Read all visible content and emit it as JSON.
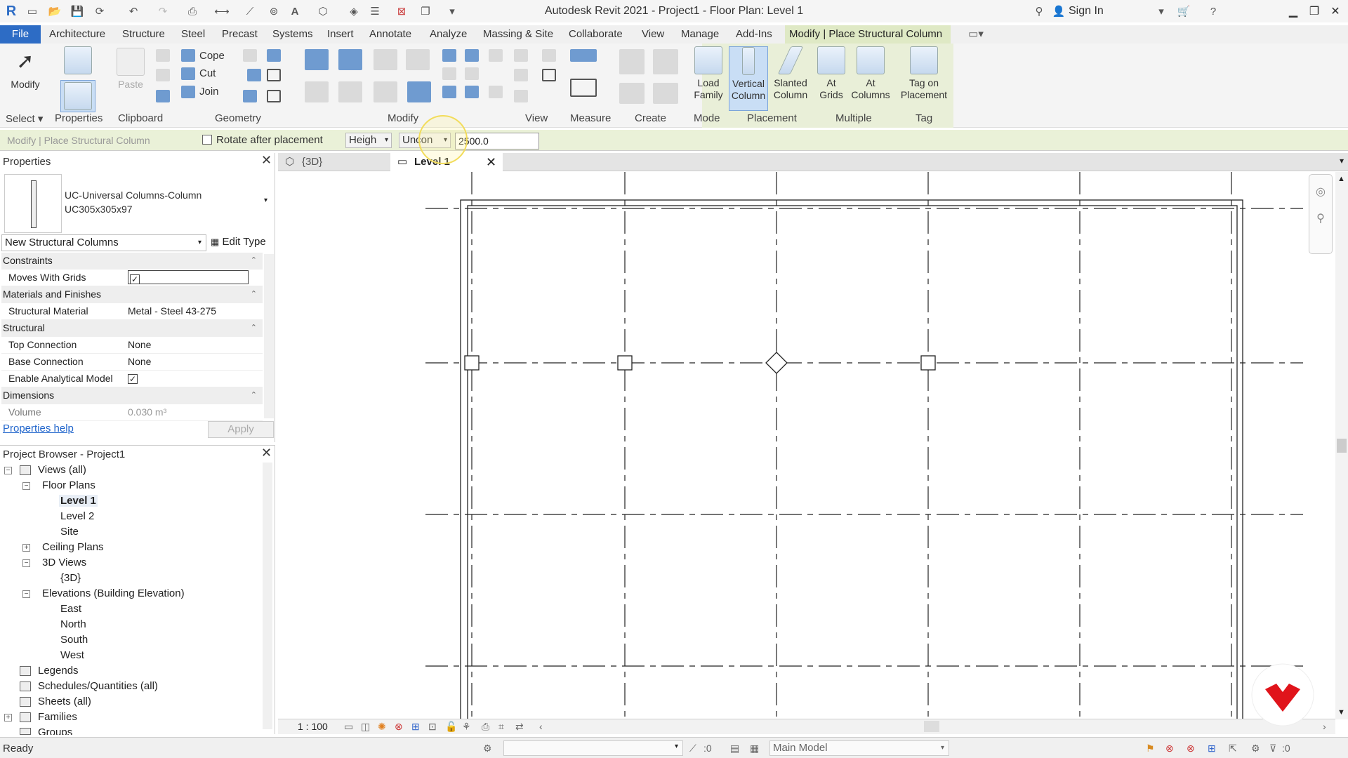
{
  "titlebar": {
    "title": "Autodesk Revit 2021 - Project1 - Floor Plan: Level 1",
    "signin": "Sign In",
    "app_glyph": "R",
    "minimize": "▁",
    "restore": "❐",
    "close": "✕"
  },
  "ribbon_tabs": [
    {
      "label": "File"
    },
    {
      "label": "Architecture"
    },
    {
      "label": "Structure"
    },
    {
      "label": "Steel"
    },
    {
      "label": "Precast"
    },
    {
      "label": "Systems"
    },
    {
      "label": "Insert"
    },
    {
      "label": "Annotate"
    },
    {
      "label": "Analyze"
    },
    {
      "label": "Massing & Site"
    },
    {
      "label": "Collaborate"
    },
    {
      "label": "View"
    },
    {
      "label": "Manage"
    },
    {
      "label": "Add-Ins"
    },
    {
      "label": "Modify | Place Structural Column"
    }
  ],
  "ribbon": {
    "modify": "Modify",
    "paste": "Paste",
    "cope": "Cope",
    "cut": "Cut",
    "join": "Join",
    "load_family": [
      "Load",
      "Family"
    ],
    "vertical_column": [
      "Vertical",
      "Column"
    ],
    "slanted_column": [
      "Slanted",
      "Column"
    ],
    "at_grids": [
      "At",
      "Grids"
    ],
    "at_columns": [
      "At",
      "Columns"
    ],
    "tag_on_placement": [
      "Tag on",
      "Placement"
    ],
    "panels": [
      "Select",
      "Properties",
      "Clipboard",
      "Geometry",
      "Modify",
      "View",
      "Measure",
      "Create",
      "Mode",
      "Placement",
      "Multiple",
      "Tag"
    ]
  },
  "options_bar": {
    "context": "Modify | Place Structural Column",
    "rotate_label": "Rotate after placement",
    "height_mode": "Heigh",
    "level": "Uncon",
    "value": "2500.0"
  },
  "properties": {
    "title": "Properties",
    "type_name_1": "UC-Universal Columns-Column",
    "type_name_2": "UC305x305x97",
    "instance_filter": "New Structural Columns",
    "edit_type": "Edit Type",
    "groups": {
      "constraints": "Constraints",
      "materials": "Materials and Finishes",
      "structural": "Structural",
      "dimensions": "Dimensions"
    },
    "rows": {
      "moves_with_grids": "Moves With Grids",
      "structural_material": "Structural Material",
      "structural_material_val": "Metal - Steel 43-275",
      "top_connection": "Top Connection",
      "top_connection_val": "None",
      "base_connection": "Base Connection",
      "base_connection_val": "None",
      "enable_analytical": "Enable Analytical Model",
      "volume": "Volume",
      "volume_val": "0.030 m³"
    },
    "help": "Properties help",
    "apply": "Apply"
  },
  "browser": {
    "title": "Project Browser - Project1",
    "views_all": "Views (all)",
    "floor_plans": "Floor Plans",
    "level1": "Level 1",
    "level2": "Level 2",
    "site": "Site",
    "ceiling_plans": "Ceiling Plans",
    "views_3d": "3D Views",
    "view_3d": "{3D}",
    "elevations": "Elevations (Building Elevation)",
    "east": "East",
    "north": "North",
    "south": "South",
    "west": "West",
    "legends": "Legends",
    "schedules": "Schedules/Quantities (all)",
    "sheets": "Sheets (all)",
    "families": "Families",
    "groups": "Groups"
  },
  "view_tabs": {
    "tab_3d": "{3D}",
    "tab_level1": "Level 1"
  },
  "view_control": {
    "scale": "1 : 100"
  },
  "status": {
    "text": "Ready",
    "count": ":0",
    "model": "Main Model",
    "filter": ":0"
  },
  "colors": {
    "file_tab": "#2d6cc5",
    "context_tab": "#dfe9c5",
    "logo_red": "#e0141b"
  }
}
